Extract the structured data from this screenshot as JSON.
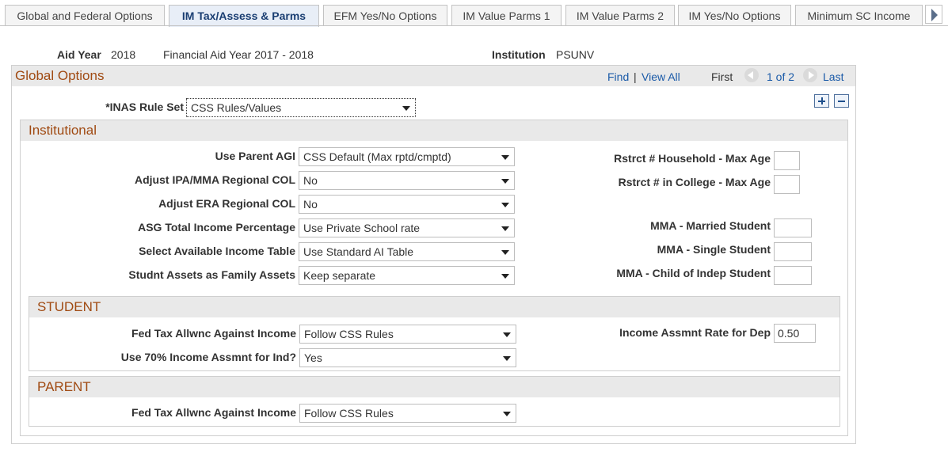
{
  "tabs": [
    {
      "label": "Global and Federal Options",
      "active": false
    },
    {
      "label": "IM Tax/Assess & Parms",
      "active": true
    },
    {
      "label": "EFM Yes/No Options",
      "active": false
    },
    {
      "label": "IM Value Parms 1",
      "active": false
    },
    {
      "label": "IM Value Parms 2",
      "active": false
    },
    {
      "label": "IM Yes/No Options",
      "active": false
    },
    {
      "label": "Minimum SC Income",
      "active": false
    }
  ],
  "header": {
    "aid_year_label": "Aid Year",
    "aid_year_value": "2018",
    "aid_year_desc": "Financial Aid Year 2017 - 2018",
    "institution_label": "Institution",
    "institution_value": "PSUNV"
  },
  "global": {
    "title": "Global Options",
    "find": "Find",
    "separator": "|",
    "view_all": "View All",
    "first": "First",
    "page_info": "1 of 2",
    "last": "Last",
    "inas_label": "*INAS Rule Set",
    "inas_value": "CSS Rules/Values"
  },
  "institutional": {
    "title": "Institutional",
    "fields": [
      {
        "label": "Use Parent AGI",
        "value": "CSS Default (Max rptd/cmptd)"
      },
      {
        "label": "Adjust IPA/MMA Regional COL",
        "value": "No"
      },
      {
        "label": "Adjust ERA Regional COL",
        "value": "No"
      },
      {
        "label": "ASG Total Income Percentage",
        "value": "Use Private School rate"
      },
      {
        "label": "Select Available Income Table",
        "value": "Use Standard AI Table"
      },
      {
        "label": "Studnt Assets as Family Assets",
        "value": "Keep separate"
      }
    ],
    "right_fields": [
      {
        "label": "Rstrct # Household - Max Age",
        "value": ""
      },
      {
        "label": "Rstrct # in College - Max Age",
        "value": ""
      },
      {
        "label": "MMA - Married Student",
        "value": ""
      },
      {
        "label": "MMA - Single Student",
        "value": ""
      },
      {
        "label": "MMA - Child of Indep Student",
        "value": ""
      }
    ]
  },
  "student": {
    "title": "STUDENT",
    "fields": [
      {
        "label": "Fed Tax Allwnc Against Income",
        "value": "Follow CSS Rules"
      },
      {
        "label": "Use 70% Income Assmnt for Ind?",
        "value": "Yes"
      }
    ],
    "rate_label": "Income Assmnt Rate for Dep",
    "rate_value": "0.50"
  },
  "parent": {
    "title": "PARENT",
    "fields": [
      {
        "label": "Fed Tax Allwnc Against Income",
        "value": "Follow CSS Rules"
      }
    ]
  }
}
